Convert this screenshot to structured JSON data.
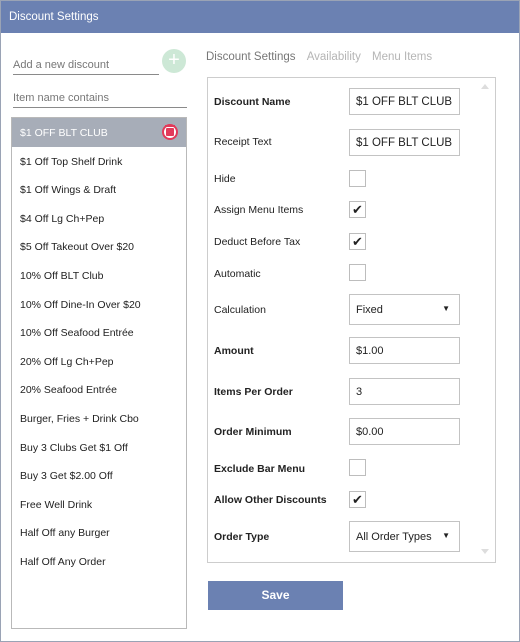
{
  "window": {
    "title": "Discount Settings"
  },
  "left": {
    "new_discount_placeholder": "Add a new discount",
    "add_button_label": "+",
    "filter_placeholder": "Item name contains",
    "items": [
      "$1 OFF BLT CLUB",
      "$1 Off Top Shelf Drink",
      "$1 Off Wings & Draft",
      "$4 Off Lg Ch+Pep",
      "$5 Off Takeout Over $20",
      "10% Off BLT Club",
      "10% Off Dine-In Over $20",
      "10% Off Seafood Entrée",
      "20% Off Lg Ch+Pep",
      "20% Seafood Entrée",
      "Burger, Fries + Drink Cbo",
      "Buy 3 Clubs Get $1 Off",
      "Buy 3 Get $2.00 Off",
      "Free Well Drink",
      "Half Off any Burger",
      "Half Off Any Order"
    ],
    "selected_index": 0
  },
  "tabs": [
    "Discount Settings",
    "Availability",
    "Menu Items"
  ],
  "form": {
    "discount_name_label": "Discount Name",
    "discount_name_value": "$1 OFF BLT CLUB",
    "receipt_text_label": "Receipt Text",
    "receipt_text_value": "$1 OFF BLT CLUB",
    "hide_label": "Hide",
    "hide_checked": false,
    "assign_menu_items_label": "Assign Menu Items",
    "assign_menu_items_checked": true,
    "deduct_before_tax_label": "Deduct Before Tax",
    "deduct_before_tax_checked": true,
    "automatic_label": "Automatic",
    "automatic_checked": false,
    "calculation_label": "Calculation",
    "calculation_value": "Fixed",
    "amount_label": "Amount",
    "amount_value": "$1.00",
    "items_per_order_label": "Items Per Order",
    "items_per_order_value": "3",
    "order_minimum_label": "Order Minimum",
    "order_minimum_value": "$0.00",
    "exclude_bar_menu_label": "Exclude Bar Menu",
    "exclude_bar_menu_checked": false,
    "allow_other_discounts_label": "Allow Other Discounts",
    "allow_other_discounts_checked": true,
    "order_type_label": "Order Type",
    "order_type_value": "All Order Types"
  },
  "save_label": "Save",
  "colors": {
    "titlebar": "#6b81b2",
    "save_button": "#6b81b2",
    "delete": "#e23a5a",
    "add_button": "#cde8d6",
    "selected_row": "#a7adb8"
  },
  "icons": {
    "add": "plus-icon",
    "delete": "trash-icon",
    "dropdown": "caret-down-icon",
    "check": "checkmark-icon"
  }
}
